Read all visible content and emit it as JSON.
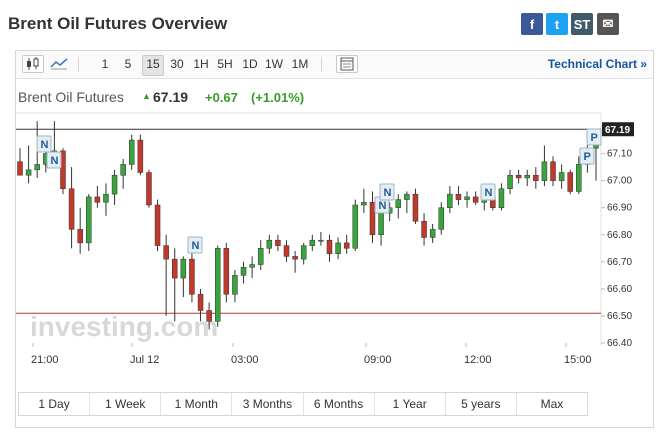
{
  "header": {
    "title": "Brent Oil Futures Overview",
    "share": [
      {
        "name": "facebook-icon",
        "glyph": "f",
        "color": "#3b5998"
      },
      {
        "name": "twitter-icon",
        "glyph": "t",
        "color": "#1da1f2"
      },
      {
        "name": "stocktwits-icon",
        "glyph": "ST",
        "color": "#405a6a"
      },
      {
        "name": "email-icon",
        "glyph": "✉",
        "color": "#555555"
      }
    ]
  },
  "toolbar": {
    "chart_type_icons": [
      "candlestick-icon",
      "area-chart-icon"
    ],
    "intervals": [
      "1",
      "5",
      "15",
      "30",
      "1H",
      "5H",
      "1D",
      "1W",
      "1M"
    ],
    "active_interval": "15",
    "settings_icon": "table-icon",
    "technical_link": "Technical Chart »"
  },
  "quote": {
    "name": "Brent Oil Futures",
    "price": "67.19",
    "change": "+0.67",
    "change_pct": "(+1.01%)",
    "color_up": "#3a9b2c"
  },
  "chart_data": {
    "type": "candlestick",
    "ylim": [
      66.4,
      67.25
    ],
    "y_ticks": [
      "67.10",
      "67.00",
      "66.90",
      "66.80",
      "66.70",
      "66.60",
      "66.50",
      "66.40"
    ],
    "x_ticks": [
      "21:00",
      "Jul 12",
      "03:00",
      "09:00",
      "12:00",
      "15:00"
    ],
    "current_price_label": "67.19",
    "reference_line": 66.51,
    "colors": {
      "up": "#3aa33d",
      "down": "#c0392b"
    },
    "watermark": "investing.com",
    "news_markers": [
      "N",
      "N",
      "N",
      "N",
      "N",
      "N",
      "P",
      "P"
    ],
    "candles": [
      [
        67.07,
        67.12,
        67.04,
        67.02
      ],
      [
        67.02,
        67.13,
        66.99,
        67.04
      ],
      [
        67.04,
        67.22,
        67.01,
        67.06
      ],
      [
        67.06,
        67.15,
        67.03,
        67.1
      ],
      [
        67.1,
        67.22,
        67.05,
        67.11
      ],
      [
        67.11,
        67.12,
        66.95,
        66.97
      ],
      [
        66.97,
        67.05,
        66.75,
        66.82
      ],
      [
        66.82,
        66.9,
        66.73,
        66.77
      ],
      [
        66.77,
        66.95,
        66.74,
        66.94
      ],
      [
        66.94,
        66.98,
        66.9,
        66.92
      ],
      [
        66.92,
        66.99,
        66.87,
        66.95
      ],
      [
        66.95,
        67.04,
        66.91,
        67.02
      ],
      [
        67.02,
        67.08,
        66.97,
        67.06
      ],
      [
        67.06,
        67.17,
        67.04,
        67.15
      ],
      [
        67.15,
        67.17,
        67.02,
        67.03
      ],
      [
        67.03,
        67.04,
        66.9,
        66.91
      ],
      [
        66.91,
        66.93,
        66.74,
        66.76
      ],
      [
        66.76,
        66.8,
        66.5,
        66.71
      ],
      [
        66.71,
        66.75,
        66.48,
        66.64
      ],
      [
        66.64,
        66.72,
        66.57,
        66.71
      ],
      [
        66.71,
        66.74,
        66.55,
        66.58
      ],
      [
        66.58,
        66.6,
        66.48,
        66.52
      ],
      [
        66.52,
        66.55,
        66.45,
        66.48
      ],
      [
        66.48,
        66.76,
        66.46,
        66.75
      ],
      [
        66.75,
        66.77,
        66.55,
        66.58
      ],
      [
        66.58,
        66.67,
        66.55,
        66.65
      ],
      [
        66.65,
        66.7,
        66.62,
        66.68
      ],
      [
        66.68,
        66.72,
        66.64,
        66.69
      ],
      [
        66.69,
        66.78,
        66.67,
        66.75
      ],
      [
        66.75,
        66.8,
        66.73,
        66.78
      ],
      [
        66.78,
        66.8,
        66.74,
        66.76
      ],
      [
        66.76,
        66.78,
        66.7,
        66.72
      ],
      [
        66.72,
        66.74,
        66.66,
        66.71
      ],
      [
        66.71,
        66.77,
        66.69,
        66.76
      ],
      [
        66.76,
        66.8,
        66.74,
        66.78
      ],
      [
        66.78,
        66.81,
        66.76,
        66.78
      ],
      [
        66.78,
        66.8,
        66.7,
        66.73
      ],
      [
        66.73,
        66.79,
        66.71,
        66.77
      ],
      [
        66.77,
        66.8,
        66.73,
        66.75
      ],
      [
        66.75,
        66.93,
        66.74,
        66.91
      ],
      [
        66.91,
        66.97,
        66.88,
        66.92
      ],
      [
        66.92,
        66.96,
        66.77,
        66.8
      ],
      [
        66.8,
        66.9,
        66.76,
        66.88
      ],
      [
        66.88,
        66.92,
        66.85,
        66.9
      ],
      [
        66.9,
        66.95,
        66.86,
        66.93
      ],
      [
        66.93,
        66.96,
        66.88,
        66.95
      ],
      [
        66.95,
        66.97,
        66.84,
        66.85
      ],
      [
        66.85,
        66.88,
        66.76,
        66.79
      ],
      [
        66.79,
        66.84,
        66.77,
        66.82
      ],
      [
        66.82,
        66.92,
        66.8,
        66.9
      ],
      [
        66.9,
        66.98,
        66.88,
        66.95
      ],
      [
        66.95,
        66.98,
        66.91,
        66.93
      ],
      [
        66.93,
        66.96,
        66.9,
        66.94
      ],
      [
        66.94,
        66.96,
        66.91,
        66.92
      ],
      [
        66.92,
        66.97,
        66.89,
        66.94
      ],
      [
        66.94,
        66.96,
        66.89,
        66.9
      ],
      [
        66.9,
        66.99,
        66.89,
        66.97
      ],
      [
        66.97,
        67.04,
        66.95,
        67.02
      ],
      [
        67.02,
        67.04,
        66.99,
        67.01
      ],
      [
        67.01,
        67.04,
        66.98,
        67.02
      ],
      [
        67.02,
        67.05,
        66.97,
        67.0
      ],
      [
        67.0,
        67.13,
        66.98,
        67.07
      ],
      [
        67.07,
        67.09,
        66.98,
        67.0
      ],
      [
        67.0,
        67.06,
        66.97,
        67.03
      ],
      [
        67.03,
        67.04,
        66.95,
        66.96
      ],
      [
        66.96,
        67.09,
        66.95,
        67.06
      ],
      [
        67.06,
        67.14,
        67.03,
        67.12
      ],
      [
        67.12,
        67.15,
        67.0,
        67.19
      ]
    ]
  },
  "ranges": [
    "1 Day",
    "1 Week",
    "1 Month",
    "3 Months",
    "6 Months",
    "1 Year",
    "5 years",
    "Max"
  ]
}
